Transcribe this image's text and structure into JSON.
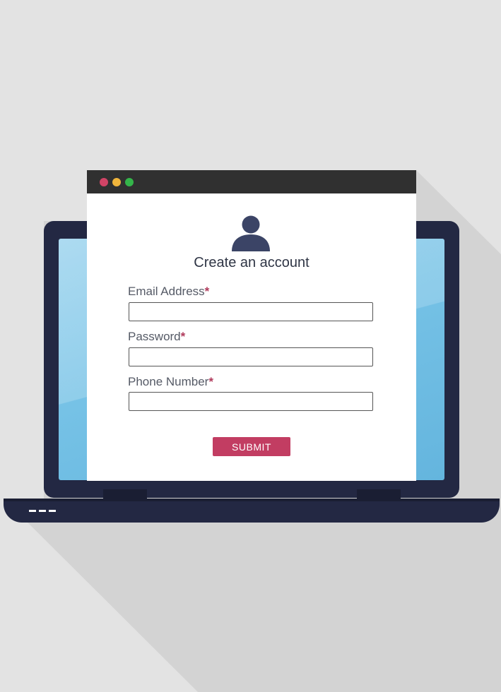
{
  "colors": {
    "background": "#e3e3e3",
    "laptop_body": "#232843",
    "screen": "#76c2e6",
    "titlebar": "#303030",
    "dot_close": "#d14466",
    "dot_minimize": "#f0b53c",
    "dot_maximize": "#34b54a",
    "avatar": "#3b4466",
    "accent": "#c23d62"
  },
  "icons": {
    "avatar": "user-avatar-icon"
  },
  "form": {
    "title": "Create an account",
    "required_marker": "*",
    "fields": [
      {
        "label": "Email Address",
        "value": "",
        "placeholder": ""
      },
      {
        "label": "Password",
        "value": "",
        "placeholder": ""
      },
      {
        "label": "Phone Number",
        "value": "",
        "placeholder": ""
      }
    ],
    "submit_label": "SUBMIT"
  }
}
